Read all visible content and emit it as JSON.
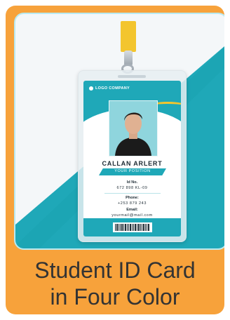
{
  "colors": {
    "frame": "#f7a23b",
    "accent_teal": "#1fa8b8",
    "accent_gold": "#f3c52e",
    "panel": "#f4f7f9"
  },
  "card": {
    "logo_text": "LOGO COMPANY",
    "name": "CALLAN ARLERT",
    "position": "YOUR POSITION",
    "id_label": "Id No.",
    "id_value": "672 898 KL-09",
    "phone_label": "Phone:",
    "phone_value": "+253 879 243",
    "email_label": "Email:",
    "email_value": "yourmail@mail.com",
    "photo_icon": "person-portrait-icon",
    "logo_icon": "logo-mark-icon",
    "barcode_icon": "barcode-icon"
  },
  "caption": {
    "line1": "Student ID Card",
    "line2": "in Four Color"
  }
}
